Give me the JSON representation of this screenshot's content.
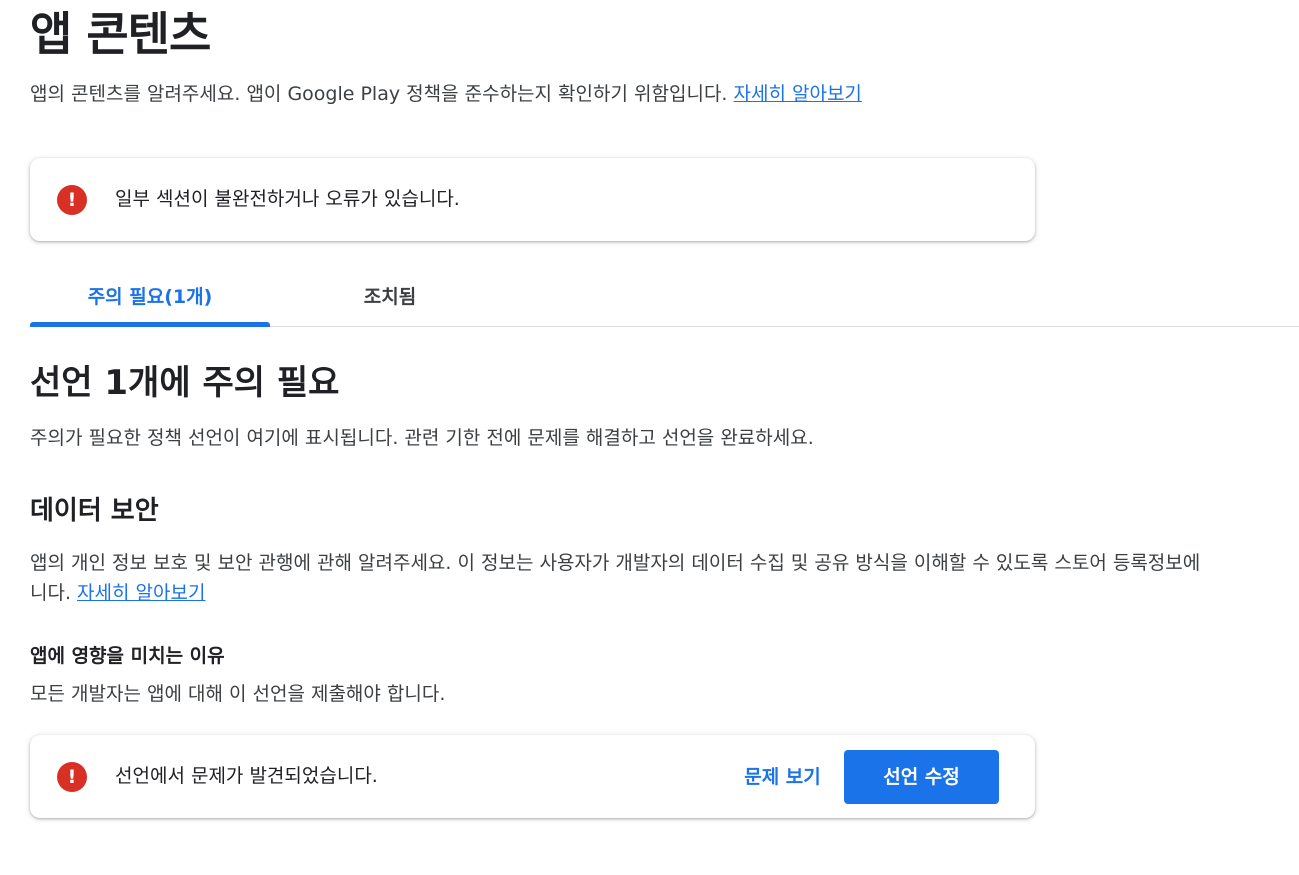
{
  "header": {
    "title": "앱 콘텐츠",
    "description": "앱의 콘텐츠를 알려주세요. 앱이 Google Play 정책을 준수하는지 확인하기 위함입니다.",
    "learn_more": "자세히 알아보기"
  },
  "error_banner": {
    "icon": "error-icon",
    "message": "일부 섹션이 불완전하거나 오류가 있습니다."
  },
  "tabs": [
    {
      "label": "주의 필요(1개)",
      "selected": true
    },
    {
      "label": "조치됨",
      "selected": false
    }
  ],
  "section": {
    "title": "선언 1개에 주의 필요",
    "description": "주의가 필요한 정책 선언이 여기에 표시됩니다. 관련 기한 전에 문제를 해결하고 선언을 완료하세요."
  },
  "data_safety": {
    "title": "데이터 보안",
    "description_line1": "앱의 개인 정보 보호 및 보안 관행에 관해 알려주세요. 이 정보는 사용자가 개발자의 데이터 수집 및 공유 방식을 이해할 수 있도록 스토어 등록정보에",
    "description_line2": "니다.",
    "learn_more": "자세히 알아보기",
    "reason_title": "앱에 영향을 미치는 이유",
    "reason_text": "모든 개발자는 앱에 대해 이 선언을 제출해야 합니다.",
    "issue": {
      "icon": "error-icon",
      "message": "선언에서 문제가 발견되었습니다.",
      "view_issues_label": "문제 보기",
      "edit_label": "선언 수정"
    }
  },
  "colors": {
    "accent": "#1a73e8",
    "error": "#d93025",
    "text_primary": "#202124",
    "text_secondary": "#3c4043",
    "divider": "#dadce0"
  }
}
